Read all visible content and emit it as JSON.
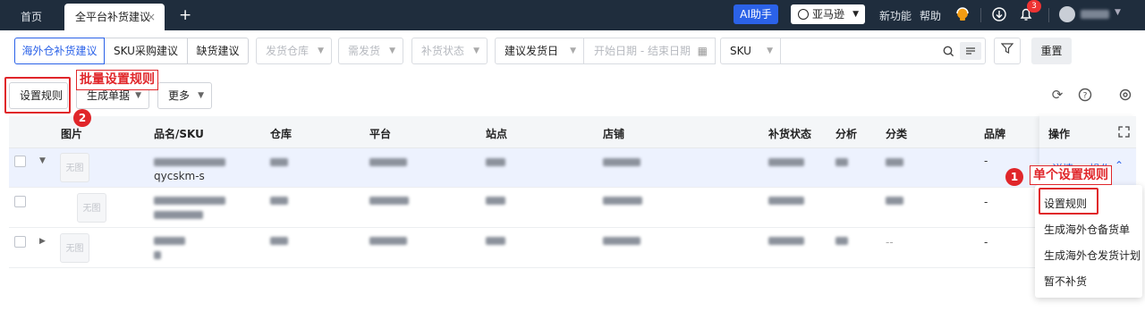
{
  "topbar": {
    "tabs": [
      {
        "label": "首页"
      },
      {
        "label": "全平台补货建议",
        "close": "×"
      }
    ],
    "add": "+",
    "ai_label": "AI助手",
    "store_select": "亚马逊",
    "links": [
      "新功能",
      "帮助"
    ],
    "notification_count": "3"
  },
  "filters": {
    "segments": [
      "海外仓补货建议",
      "SKU采购建议",
      "缺货建议"
    ],
    "selects": [
      "发货仓库",
      "需发货",
      "补货状态"
    ],
    "date_type": "建议发货日",
    "date_placeholder": "开始日期  -  结束日期",
    "sku_type": "SKU",
    "reset": "重置"
  },
  "toolbar": {
    "set_rule": "设置规则",
    "generate": "生成单据",
    "more": "更多"
  },
  "annotations": {
    "batch_label": "批量设置规则",
    "batch_num": "2",
    "single_label": "单个设置规则",
    "single_num": "1"
  },
  "table": {
    "headers": [
      "图片",
      "品名/SKU",
      "仓库",
      "平台",
      "站点",
      "店铺",
      "补货状态",
      "分析",
      "分类",
      "品牌",
      "操作"
    ],
    "no_image": "无图",
    "rows": [
      {
        "sku_suffix": "qycskm-s",
        "brand": "-",
        "detail": "详情",
        "ops": "操作"
      },
      {
        "brand": "-"
      },
      {
        "brand": "-",
        "category": "--"
      }
    ]
  },
  "dropdown": {
    "items": [
      "设置规则",
      "生成海外仓备货单",
      "生成海外仓发货计划",
      "暂不补货"
    ]
  },
  "colors": {
    "accent": "#2b62e8",
    "topbar": "#1f2d3d",
    "highlight": "#e0262a"
  }
}
